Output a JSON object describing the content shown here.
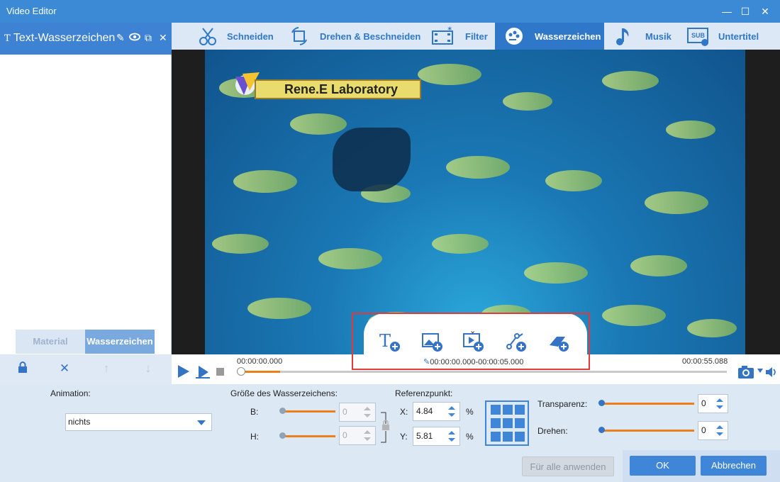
{
  "window": {
    "title": "Video Editor",
    "minimize": "—",
    "maximize": "☐",
    "close": "✕"
  },
  "left_panel": {
    "header_label": "Text-Wasserzeichen",
    "tabs": {
      "material": "Material",
      "watermark": "Wasserzeichen"
    }
  },
  "tabs": [
    {
      "label": "Schneiden"
    },
    {
      "label": "Drehen & Beschneiden"
    },
    {
      "label": "Filter"
    },
    {
      "label": "Wasserzeichen"
    },
    {
      "label": "Musik"
    },
    {
      "label": "Untertitel"
    }
  ],
  "active_tab": "Wasserzeichen",
  "video": {
    "watermark_text": "Rene.E Laboratory"
  },
  "timeline": {
    "start_time": "00:00:00.000",
    "end_time": "00:00:55.088",
    "watermark_range": "00:00:00.000-00:00:05.000",
    "progress_fraction": 0.08
  },
  "settings": {
    "animation_label": "Animation:",
    "animation_value": "nichts",
    "size_label": "Größe des Wasserzeichens:",
    "b_label": "B:",
    "b_value": "0",
    "h_label": "H:",
    "h_value": "0",
    "ref_label": "Referenzpunkt:",
    "x_label": "X:",
    "x_value": "4.84",
    "x_unit": "%",
    "y_label": "Y:",
    "y_value": "5.81",
    "y_unit": "%",
    "transparency_label": "Transparenz:",
    "transparency_value": "0",
    "rotate_label": "Drehen:",
    "rotate_value": "0"
  },
  "buttons": {
    "apply_all": "Für alle anwenden",
    "ok": "OK",
    "cancel": "Abbrechen"
  },
  "colors": {
    "accent": "#2f78c9",
    "progress": "#ee7d1c",
    "highlight": "#e23a3a"
  }
}
